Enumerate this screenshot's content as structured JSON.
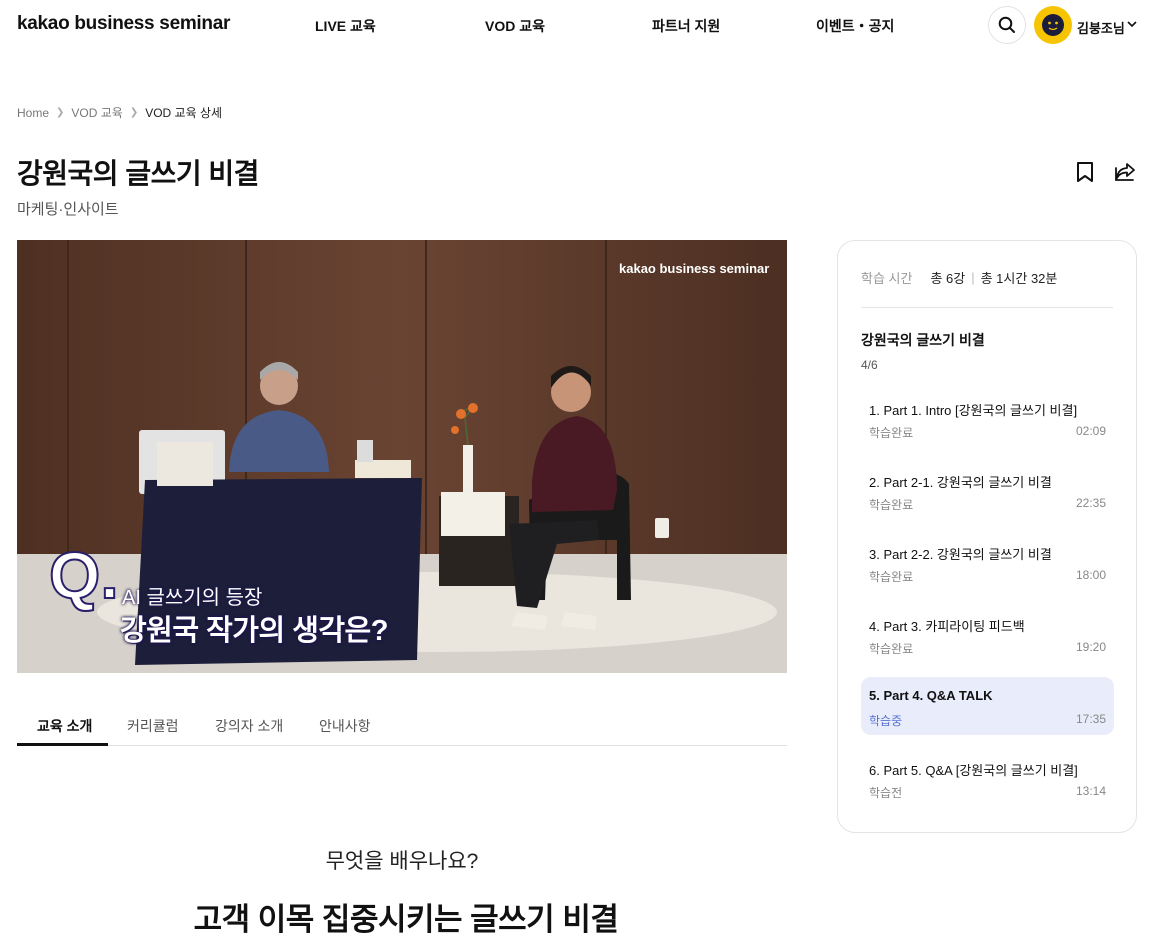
{
  "header": {
    "logo": "kakao business seminar",
    "nav": [
      "LIVE 교육",
      "VOD 교육",
      "파트너 지원",
      "이벤트・공지"
    ],
    "user_name": "김붕조님"
  },
  "breadcrumb": [
    "Home",
    "VOD 교육",
    "VOD 교육 상세"
  ],
  "page": {
    "title": "강원국의 글쓰기 비결",
    "category": "마케팅·인사이트"
  },
  "video": {
    "watermark": "kakao business seminar",
    "caption_q": "Q.",
    "caption_line1": "AI 글쓰기의 등장",
    "caption_line2": "강원국 작가의 생각은?"
  },
  "tabs": [
    "교육 소개",
    "커리큘럼",
    "강의자 소개",
    "안내사항"
  ],
  "active_tab": "교육 소개",
  "intro": {
    "question": "무엇을 배우나요?",
    "headline": "고객 이목 집중시키는 글쓰기 비결"
  },
  "panel": {
    "study_time_label": "학습 시간",
    "total_lessons": "총 6강",
    "total_time": "총 1시간 32분",
    "course_name": "강원국의 글쓰기 비결",
    "progress": "4/6",
    "lessons": [
      {
        "title": "1. Part 1. Intro [강원국의 글쓰기 비결]",
        "status": "학습완료",
        "time": "02:09"
      },
      {
        "title": "2. Part 2-1. 강원국의 글쓰기 비결",
        "status": "학습완료",
        "time": "22:35"
      },
      {
        "title": "3. Part 2-2. 강원국의 글쓰기 비결",
        "status": "학습완료",
        "time": "18:00"
      },
      {
        "title": "4. Part 3. 카피라이팅 피드백",
        "status": "학습완료",
        "time": "19:20"
      },
      {
        "title": "5. Part 4. Q&A TALK",
        "status": "학습중",
        "time": "17:35"
      },
      {
        "title": "6. Part 5. Q&A [강원국의 글쓰기 비결]",
        "status": "학습전",
        "time": "13:14"
      }
    ]
  },
  "colors": {
    "accent_highlight": "#e8ecfb",
    "in_progress": "#5a72d6",
    "avatar_bg": "#f6c400"
  }
}
